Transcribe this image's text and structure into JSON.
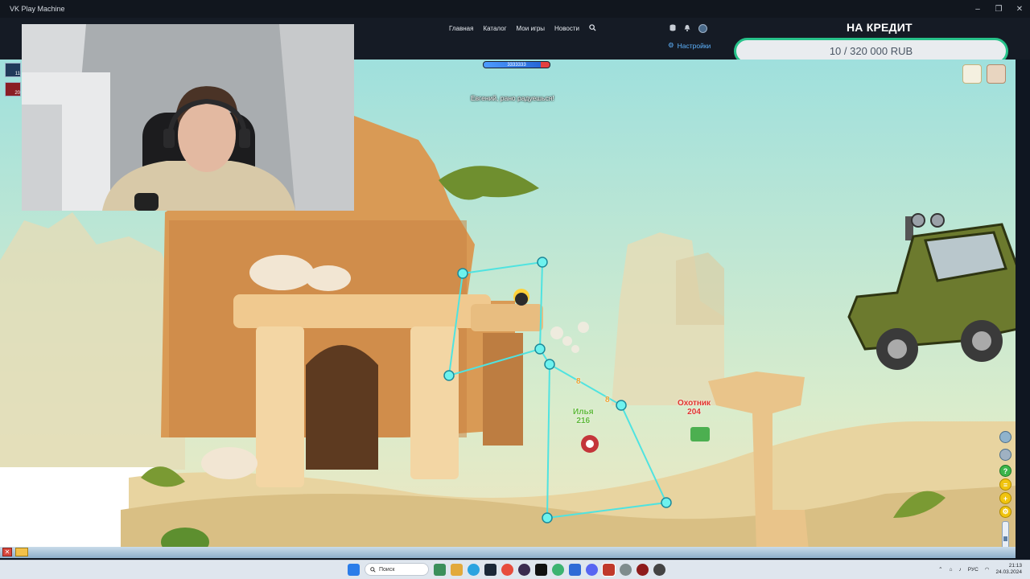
{
  "window": {
    "title": "VK Play Machine",
    "controls": [
      "–",
      "❐",
      "✕"
    ]
  },
  "nav": {
    "links": [
      "Главная",
      "Каталог",
      "Мои игры",
      "Новости"
    ],
    "search_icon": "search-icon",
    "settings_label": "Настройки"
  },
  "credit": {
    "title": "НА КРЕДИТ",
    "amount_text": "10 / 320 000 RUB",
    "progress_fraction": 3e-05,
    "accent_color": "#27c28a"
  },
  "game": {
    "chat_message": "Евгений, рано радуешься!",
    "enemy_hp_text": "3333333",
    "enemy_hp_fraction": 0.86,
    "players": [
      {
        "name": "Илья",
        "hp": "216",
        "color": "#5fb93a"
      },
      {
        "name": "Охотник",
        "hp": "204",
        "color": "#e0332e"
      }
    ],
    "damage_numbers": [
      "8",
      "8"
    ],
    "mini_players": [
      {
        "count": "11"
      },
      {
        "count": "20"
      }
    ]
  },
  "taskbar": {
    "search_placeholder": "Поиск",
    "lang": "РУС",
    "time": "21:13",
    "date": "24.03.2024"
  }
}
